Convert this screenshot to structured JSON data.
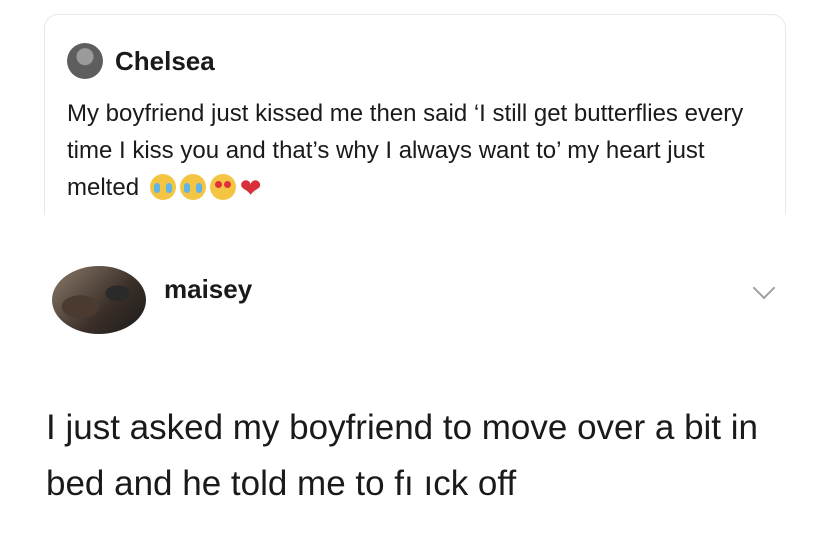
{
  "quoted_post": {
    "author": "Chelsea",
    "avatar_icon": "user-avatar-icon",
    "text": "My boyfriend just kissed me then said ‘I still get butterflies every time I kiss you and that’s why I always want to’ my heart just melted",
    "emojis": [
      "crying-face-emoji",
      "crying-face-emoji",
      "heart-eyes-emoji",
      "red-heart-emoji"
    ],
    "heart_glyph": "❤"
  },
  "reply_post": {
    "author": "maisey",
    "avatar_icon": "user-avatar-photo",
    "menu_icon": "chevron-down-icon",
    "text": "I just asked my boyfriend to move over a bit in bed and he told me to fı ıck off"
  }
}
